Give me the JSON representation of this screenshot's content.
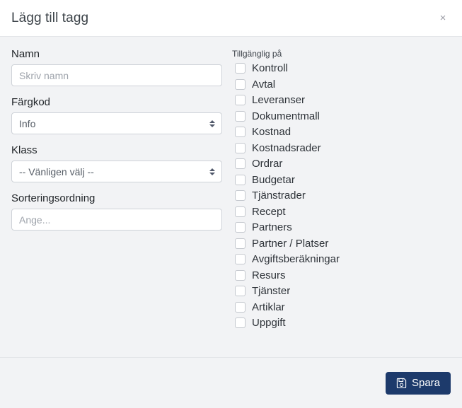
{
  "dialog": {
    "title": "Lägg till tagg",
    "close_label": "×"
  },
  "form": {
    "name": {
      "label": "Namn",
      "placeholder": "Skriv namn",
      "value": ""
    },
    "color_code": {
      "label": "Färgkod",
      "selected": "Info"
    },
    "class": {
      "label": "Klass",
      "selected": "-- Vänligen välj --"
    },
    "sort_order": {
      "label": "Sorteringsordning",
      "placeholder": "Ange...",
      "value": ""
    }
  },
  "availability": {
    "label": "Tillgänglig på",
    "items": [
      {
        "label": "Kontroll",
        "checked": false
      },
      {
        "label": "Avtal",
        "checked": false
      },
      {
        "label": "Leveranser",
        "checked": false
      },
      {
        "label": "Dokumentmall",
        "checked": false
      },
      {
        "label": "Kostnad",
        "checked": false
      },
      {
        "label": "Kostnadsrader",
        "checked": false
      },
      {
        "label": "Ordrar",
        "checked": false
      },
      {
        "label": "Budgetar",
        "checked": false
      },
      {
        "label": "Tjänstrader",
        "checked": false
      },
      {
        "label": "Recept",
        "checked": false
      },
      {
        "label": "Partners",
        "checked": false
      },
      {
        "label": "Partner / Platser",
        "checked": false
      },
      {
        "label": "Avgiftsberäkningar",
        "checked": false
      },
      {
        "label": "Resurs",
        "checked": false
      },
      {
        "label": "Tjänster",
        "checked": false
      },
      {
        "label": "Artiklar",
        "checked": false
      },
      {
        "label": "Uppgift",
        "checked": false
      }
    ]
  },
  "footer": {
    "save_label": "Spara",
    "save_icon": "save-floppy-icon"
  },
  "colors": {
    "primary": "#1d3a6b",
    "background": "#f2f3f5",
    "header_background": "#ffffff",
    "border": "#e3e5e8",
    "input_border": "#ced2d8",
    "text": "#212529",
    "placeholder": "#9ea3ab"
  }
}
